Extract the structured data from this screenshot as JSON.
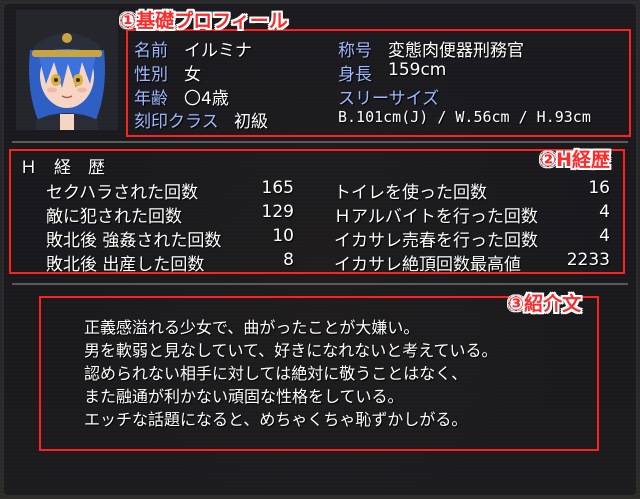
{
  "annotations": {
    "basic": "①基礎プロフィール",
    "h_history": "②H経歴",
    "intro": "③紹介文"
  },
  "profile": {
    "name_label": "名前",
    "name": "イルミナ",
    "gender_label": "性別",
    "gender": "女",
    "age_label": "年齢",
    "age": "〇4歳",
    "crest_label": "刻印クラス",
    "crest": "初級",
    "title_label": "称号",
    "title": "変態肉便器刑務官",
    "height_label": "身長",
    "height": "159cm",
    "sizes_label": "スリーサイズ",
    "sizes": "B.101cm(J) / W.56cm / H.93cm"
  },
  "history": {
    "heading": "Ｈ　経　歴",
    "left": [
      {
        "label": "セクハラされた回数",
        "value": "165"
      },
      {
        "label": "敵に犯された回数",
        "value": "129"
      },
      {
        "label": "敗北後 強姦された回数",
        "value": "10"
      },
      {
        "label": "敗北後 出産した回数",
        "value": "8"
      }
    ],
    "right": [
      {
        "label": "トイレを使った回数",
        "value": "16"
      },
      {
        "label": "Ｈアルバイトを行った回数",
        "value": "4"
      },
      {
        "label": "イカサレ売春を行った回数",
        "value": "4"
      },
      {
        "label": "イカサレ絶頂回数最高値",
        "value": "2233"
      }
    ]
  },
  "intro": {
    "lines": [
      "正義感溢れる少女で、曲がったことが大嫌い。",
      "男を軟弱と見なしていて、好きになれないと考えている。",
      "認められない相手に対しては絶対に敬うことはなく、",
      "また融通が利かない頑固な性格をしている。",
      "エッチな話題になると、めちゃくちゃ恥ずかしがる。"
    ]
  },
  "colors": {
    "label_blue": "#9fb8ff",
    "annotation_red": "#ff2020"
  },
  "icons": {
    "portrait": "character-portrait-icon"
  }
}
